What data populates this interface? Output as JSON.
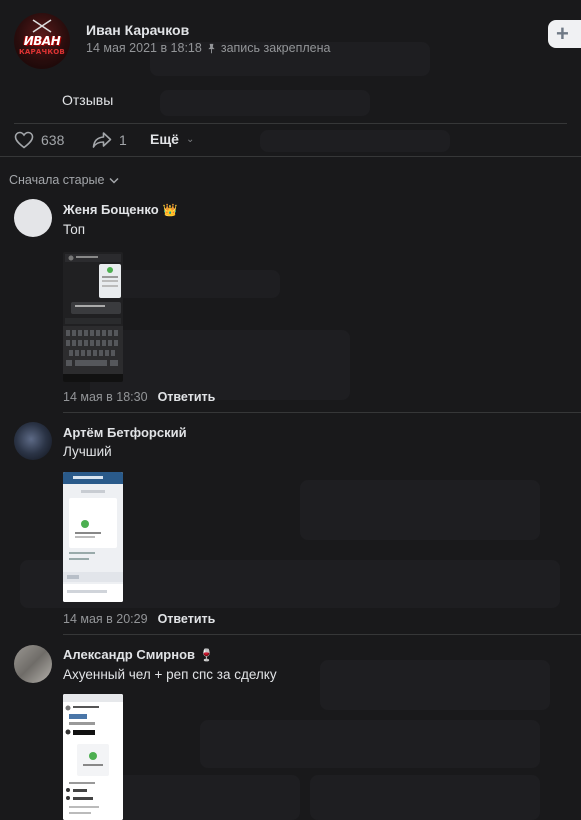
{
  "post": {
    "author": "Иван Карачков",
    "date": "14 мая 2021 в 18:18",
    "pinned_label": "запись закреплена",
    "text": "Отзывы",
    "avatar_text": "ИВАН",
    "avatar_sub": "КАРАЧКОВ"
  },
  "actions": {
    "likes": "638",
    "shares": "1",
    "more_label": "Ещё"
  },
  "sort_label": "Сначала старые",
  "comments": [
    {
      "name": "Женя Бощенко",
      "badge": "👑",
      "text": "Топ",
      "time": "14 мая в 18:30",
      "reply": "Ответить"
    },
    {
      "name": "Артём Бетфорский",
      "badge": "",
      "text": "Лучший",
      "time": "14 мая в 20:29",
      "reply": "Ответить"
    },
    {
      "name": "Александр Смирнов",
      "badge": "🍷",
      "text": "Ахуенный чел + реп спс за сделку",
      "time": "",
      "reply": ""
    }
  ],
  "colors": {
    "background": "#19191b",
    "text_primary": "#e1e3e6",
    "text_secondary": "#939598",
    "divider": "#363738"
  }
}
